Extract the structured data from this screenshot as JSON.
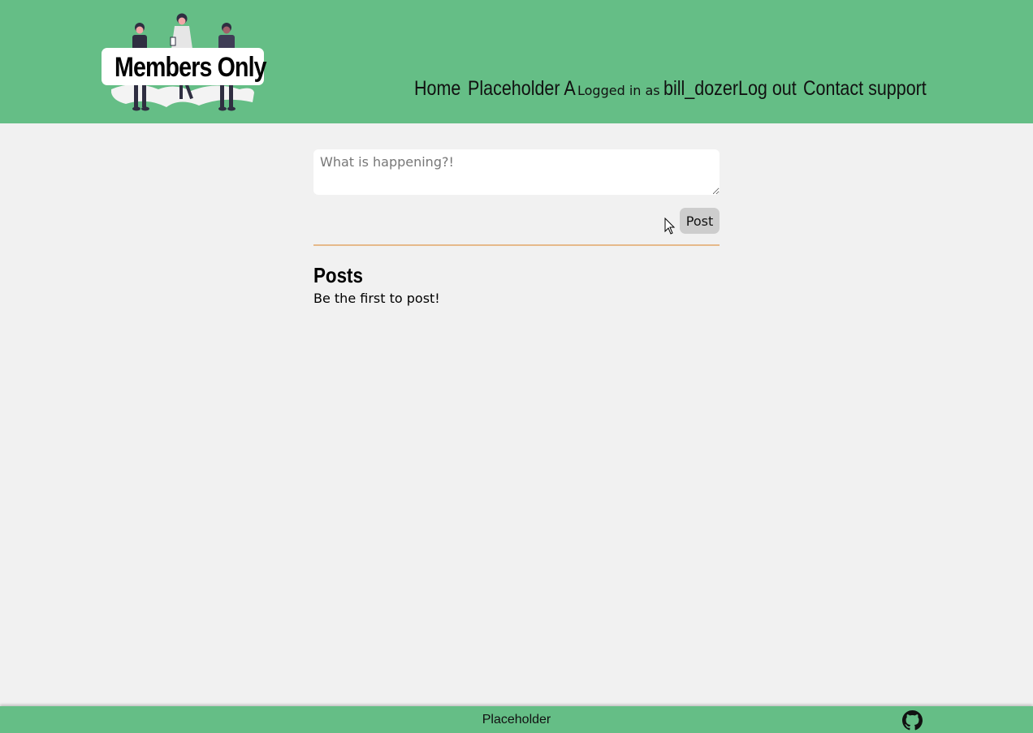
{
  "header": {
    "logo_text": "Members Only",
    "nav": {
      "home": "Home",
      "placeholder": "Placeholder A",
      "logged_in_label": "Logged in as",
      "username": "bill_dozer",
      "logout": "Log out",
      "support": "Contact support"
    }
  },
  "composer": {
    "placeholder": "What is happening?!",
    "post_label": "Post"
  },
  "posts": {
    "heading": "Posts",
    "empty_message": "Be the first to post!"
  },
  "footer": {
    "text": "Placeholder",
    "icon": "github-icon"
  },
  "colors": {
    "brand_green": "#65be86",
    "background": "#f1f1f1",
    "divider": "#e6b98a",
    "button": "#cdcdcd"
  }
}
